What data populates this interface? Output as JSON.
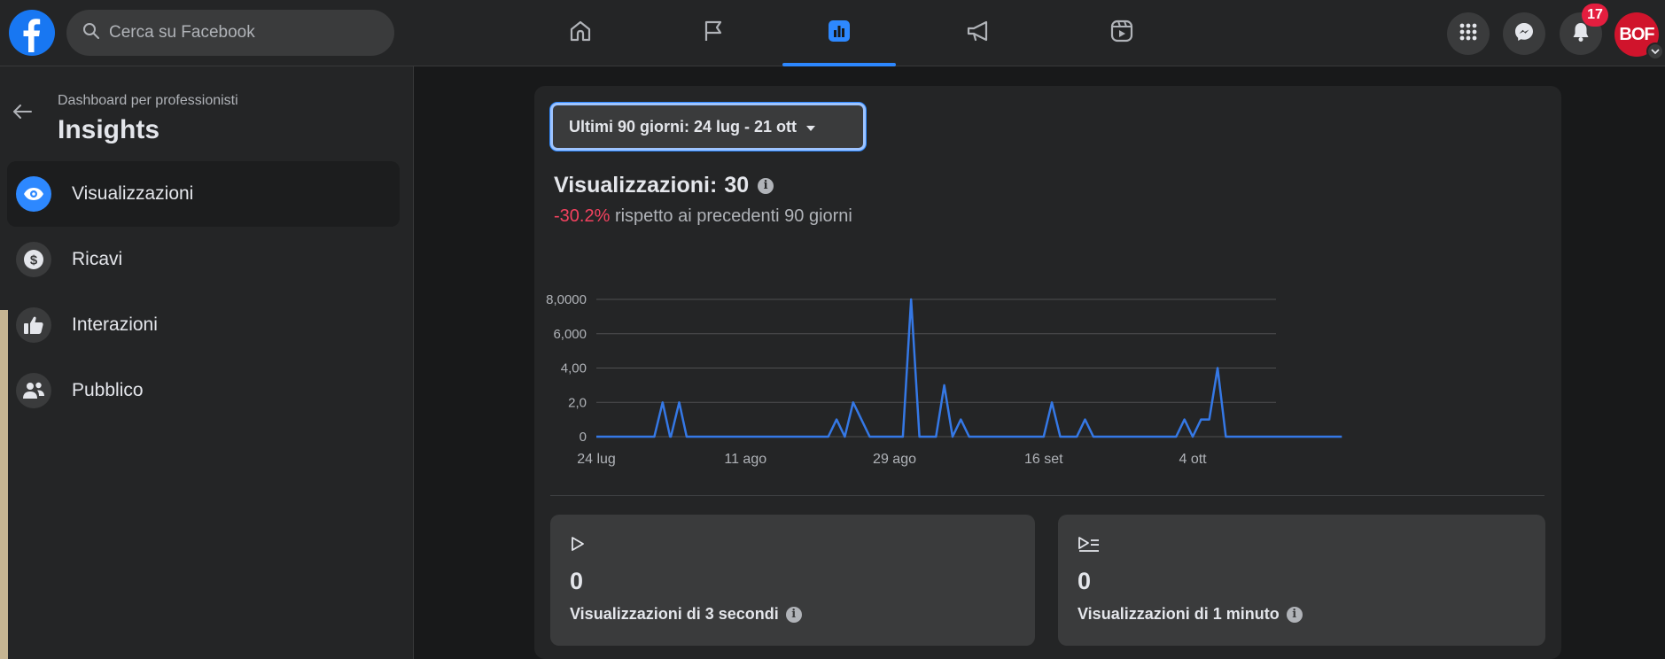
{
  "topbar": {
    "search_placeholder": "Cerca su Facebook",
    "nav_tabs": [
      "home-icon",
      "flag-icon",
      "insights-icon",
      "megaphone-icon",
      "reels-icon"
    ],
    "active_tab": "insights-icon",
    "notifications_count": "17",
    "avatar_text": "BOF"
  },
  "sidebar": {
    "subtitle": "Dashboard per professionisti",
    "title": "Insights",
    "items": [
      {
        "label": "Visualizzazioni",
        "icon": "eye-icon",
        "active": true
      },
      {
        "label": "Ricavi",
        "icon": "dollar-icon",
        "active": false
      },
      {
        "label": "Interazioni",
        "icon": "thumbs-up-icon",
        "active": false
      },
      {
        "label": "Pubblico",
        "icon": "people-icon",
        "active": false
      }
    ]
  },
  "main": {
    "date_range": "Ultimi 90 giorni: 24 lug - 21 ott",
    "metric_label": "Visualizzazioni:",
    "metric_value": "30",
    "change": "-30.2%",
    "change_suffix": "rispetto ai precedenti 90 giorni",
    "stats": [
      {
        "icon": "play-icon",
        "value": "0",
        "label": "Visualizzazioni di 3 secondi"
      },
      {
        "icon": "play-list-icon",
        "value": "0",
        "label": "Visualizzazioni di 1 minuto"
      }
    ]
  },
  "colors": {
    "accent": "#2d88ff",
    "line": "#3578e5",
    "negative": "#f3425f",
    "background": "#18191a",
    "surface": "#242526"
  },
  "chart_data": {
    "type": "line",
    "ytick_labels": [
      "0",
      "2,0",
      "4,00",
      "6,000",
      "8,0000"
    ],
    "ytick_values": [
      0,
      2,
      4,
      6,
      8
    ],
    "ylim": [
      0,
      8
    ],
    "xtick_labels": [
      "24 lug",
      "11 ago",
      "29 ago",
      "16 set",
      "4 ott"
    ],
    "xtick_days": [
      0,
      18,
      36,
      54,
      72
    ],
    "xlim": [
      0,
      92
    ],
    "grid": true,
    "series": [
      {
        "days": [
          0,
          7,
          8,
          8.9,
          9,
          10,
          10.9,
          11,
          12,
          28,
          29,
          30,
          31,
          32,
          33,
          37,
          38,
          39,
          41,
          42,
          43,
          44,
          45,
          46,
          47,
          54,
          55,
          56,
          58,
          59,
          60,
          61,
          70,
          71,
          72,
          73,
          74,
          75,
          76,
          77,
          78,
          79,
          80,
          81,
          82,
          83,
          84,
          85,
          86,
          87,
          88,
          89,
          90
        ],
        "values": [
          0,
          0,
          2,
          0,
          0,
          2,
          0,
          0,
          0,
          0,
          1,
          0,
          2,
          1,
          0,
          0,
          8,
          0,
          0,
          3,
          0,
          1,
          0,
          0,
          0,
          0,
          2,
          0,
          0,
          1,
          0,
          0,
          0,
          1,
          0,
          1,
          1,
          4,
          0,
          0,
          0,
          0,
          0,
          0,
          0,
          0,
          0,
          0,
          0,
          0,
          0,
          0,
          0
        ]
      }
    ]
  }
}
